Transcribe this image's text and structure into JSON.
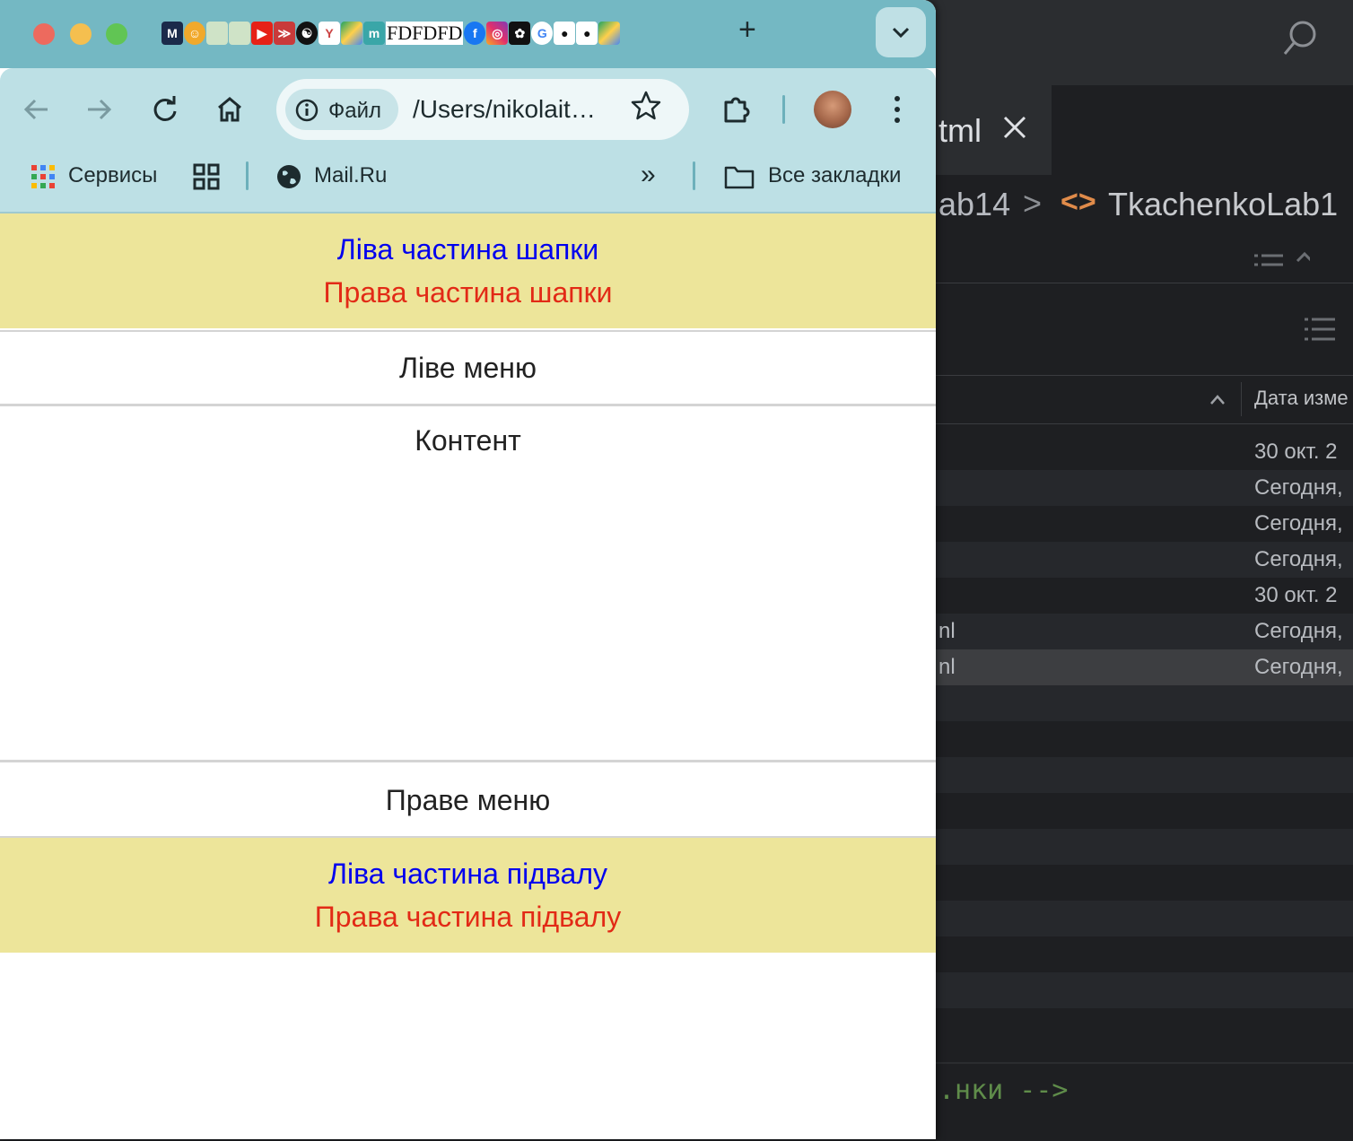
{
  "browser": {
    "new_tab": "+",
    "tab_strip_text": "FDFDFD",
    "omnibox": {
      "chip_label": "Файл",
      "url": "/Users/nikolait…"
    },
    "bookmarks": {
      "services": "Сервисы",
      "mail": "Mail.Ru",
      "more": "»",
      "all": "Все закладки"
    },
    "colors": {
      "tab_strip": "#74b8c3",
      "toolbar": "#bde0e5",
      "header_bg": "#ede59a",
      "link_blue": "#0000ee",
      "accent_red": "#e22a16"
    }
  },
  "page": {
    "header": {
      "left": "Ліва частина шапки",
      "right": "Права частина шапки"
    },
    "left_menu": "Ліве меню",
    "content": "Контент",
    "right_menu": "Праве меню",
    "footer": {
      "left": "Ліва частина підвалу",
      "right": "Права частина підвалу"
    }
  },
  "editor": {
    "tab_title": "tml",
    "breadcrumb": {
      "folder": "ab14",
      "separator": ">",
      "file": "TkachenkoLab1"
    },
    "column_date": "Дата изме",
    "rows": [
      {
        "name": "",
        "date": "30 окт. 2"
      },
      {
        "name": "",
        "date": "Сегодня,"
      },
      {
        "name": "",
        "date": "Сегодня,"
      },
      {
        "name": "",
        "date": "Сегодня,"
      },
      {
        "name": "",
        "date": "30 окт. 2"
      },
      {
        "name": "nl",
        "date": "Сегодня,"
      },
      {
        "name": "nl",
        "date": "Сегодня,"
      }
    ],
    "code_comment": ".нки -->"
  }
}
